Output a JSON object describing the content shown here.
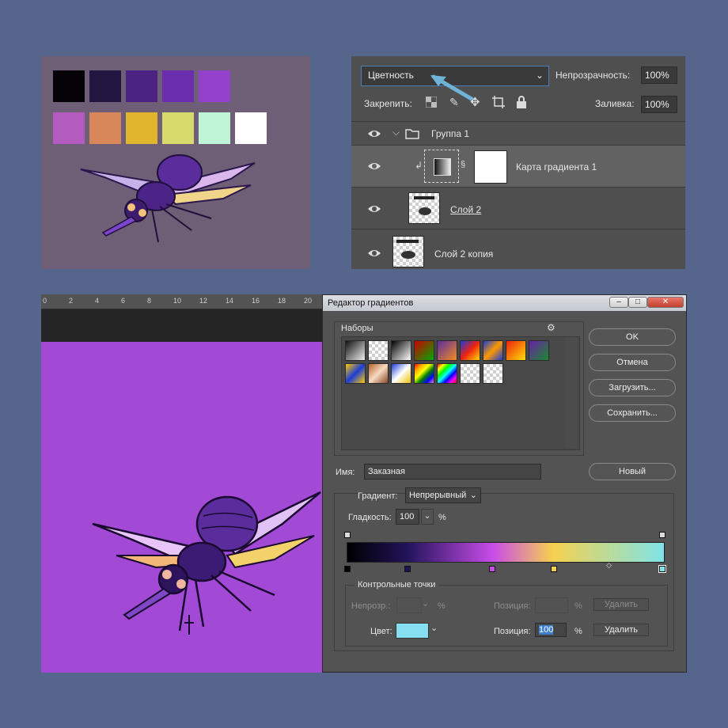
{
  "colors": {
    "background": "#56658c",
    "palette_row1": [
      "#050308",
      "#221641",
      "#4a2382",
      "#6a2dae",
      "#9340cb"
    ],
    "palette_row2": [
      "#b45bc0",
      "#d7875a",
      "#e2b52f",
      "#d9da6c",
      "#bff5d6",
      "#ffffff"
    ],
    "canvas_fill": "#a24ad6",
    "gradient_stops": [
      "#000000",
      "#22145c",
      "#c94ce8",
      "#f5d14e",
      "#80e4e8"
    ]
  },
  "layers_panel": {
    "blend_mode": "Цветность",
    "opacity_label": "Непрозрачность:",
    "opacity_value": "100%",
    "lock_label": "Закрепить:",
    "fill_label": "Заливка:",
    "fill_value": "100%",
    "layers": [
      {
        "name": "Группа 1",
        "icon": "folder-icon"
      },
      {
        "name": "Карта градиента 1",
        "icon": "gradient-map-icon"
      },
      {
        "name": "Слой 2",
        "icon": "layer-thumbnail"
      },
      {
        "name": "Слой 2 копия",
        "icon": "layer-thumbnail"
      }
    ]
  },
  "ruler": {
    "ticks": [
      "0",
      "2",
      "4",
      "6",
      "8",
      "10",
      "12",
      "14",
      "16",
      "18",
      "20"
    ]
  },
  "gradient_editor": {
    "title": "Редактор градиентов",
    "presets_label": "Наборы",
    "buttons": {
      "ok": "OK",
      "cancel": "Отмена",
      "load": "Загрузить...",
      "save": "Сохранить...",
      "new": "Новый",
      "delete_opacity": "Удалить",
      "delete_color": "Удалить"
    },
    "name_label": "Имя:",
    "name_value": "Заказная",
    "gradient_type_label": "Градиент:",
    "gradient_type_value": "Непрерывный",
    "smoothness_label": "Гладкость:",
    "smoothness_value": "100",
    "percent": "%",
    "stops_group_label": "Контрольные точки",
    "opacity_label": "Непрозр.:",
    "position_label": "Позиция:",
    "color_label": "Цвет:",
    "color_value": "#86dff0",
    "color_position_value": "100"
  }
}
